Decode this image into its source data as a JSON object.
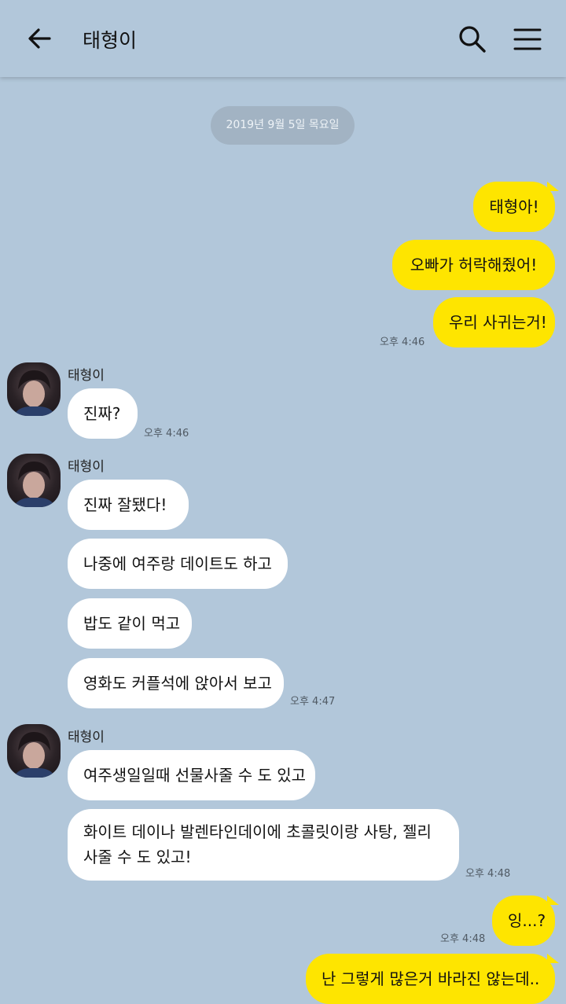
{
  "header": {
    "title": "태형이"
  },
  "date_divider": "2019년 9월 5일 목요일",
  "messages": {
    "m1": "태형아!",
    "m2": "오빠가 허락해줬어!",
    "m3": "우리 사귀는거!",
    "t1": "오후 4:46",
    "sender1": "태형이",
    "r1": "진짜?",
    "t2": "오후 4:46",
    "sender2": "태형이",
    "r2": "진짜 잘됐다!",
    "r3": "나중에 여주랑 데이트도 하고",
    "r4": "밥도 같이 먹고",
    "r5": "영화도 커플석에 앉아서 보고",
    "t3": "오후 4:47",
    "sender3": "태형이",
    "r6": "여주생일일때 선물사줄 수 도 있고",
    "r7": "화이트 데이나 발렌타인데이에 초콜릿이랑 사탕, 젤리 사줄 수 도 있고!",
    "t4": "오후 4:48",
    "m4": "잉...?",
    "t5": "오후 4:48",
    "m5": "난 그렇게 많은거 바라진 않는데.."
  },
  "colors": {
    "background": "#b2c7da",
    "my_bubble": "#fee500",
    "their_bubble": "#ffffff",
    "date_pill": "#a2b3c3"
  },
  "icons": {
    "back": "arrow-left-icon",
    "search": "search-icon",
    "menu": "menu-icon"
  }
}
